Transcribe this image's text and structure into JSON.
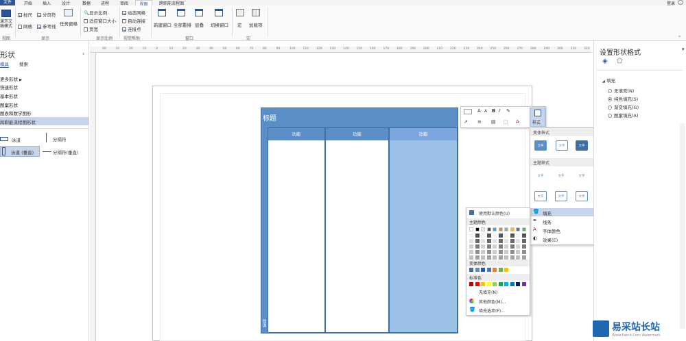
{
  "ribbon": {
    "tabs": [
      {
        "label": "文件"
      },
      {
        "label": "开始"
      },
      {
        "label": "插入"
      },
      {
        "label": "设计"
      },
      {
        "label": "数据"
      },
      {
        "label": "进程"
      },
      {
        "label": "审阅"
      },
      {
        "label": "视图"
      },
      {
        "label": "跨职能流程图"
      }
    ],
    "login": "登录",
    "present": "演示文\n稿模式",
    "checks": {
      "ruler": "标尺",
      "grid": "网格",
      "pagebreak": "分页符",
      "guides": "参考线"
    },
    "task_pane": "任务窗格",
    "zoom": {
      "show": "显示比例",
      "fit": "适应窗口大小",
      "page": "页宽"
    },
    "helpers": {
      "dyn_grid": "动态网格",
      "autoconnect": "自动连接",
      "connpoints": "连接点"
    },
    "win": {
      "new": "新建窗口",
      "all": "全部重排",
      "cascade": "层叠",
      "switch": "切换窗口"
    },
    "macro": "宏",
    "addin": "加载项",
    "groups": {
      "view": "视图",
      "show": "显示",
      "zoom": "显示比例",
      "visual": "视觉帮助",
      "window": "窗口",
      "macro": "宏"
    }
  },
  "shapes": {
    "title": "形状",
    "tab_stencil": "模具",
    "tab_search": "搜索",
    "items": [
      {
        "label": "更多形状"
      },
      {
        "label": "快速形状"
      },
      {
        "label": "基本形状"
      },
      {
        "label": "图案形状"
      },
      {
        "label": "图表和数学图形"
      },
      {
        "label": "跨职能流程图形状"
      }
    ],
    "stencil": {
      "swimlane": "泳道",
      "separator": "分隔符",
      "swimlane_v": "泳道 (垂直)",
      "separator_v": "分隔符(垂直)"
    }
  },
  "ruler_numbers": [
    "40",
    "30",
    "20",
    "10",
    "0",
    "10",
    "20",
    "30",
    "40",
    "50",
    "60",
    "70",
    "80",
    "90",
    "100",
    "110",
    "120",
    "130",
    "140",
    "150",
    "160",
    "170",
    "180",
    "190",
    "200",
    "210",
    "220",
    "230",
    "240",
    "250",
    "260",
    "270",
    "280",
    "290",
    "300",
    "310",
    "320"
  ],
  "diagram": {
    "title": "标题",
    "columns": [
      {
        "label": "功能"
      },
      {
        "label": "功能"
      },
      {
        "label": "功能"
      }
    ],
    "phase": "阶段"
  },
  "mini_toolbar": {
    "style_label": "样式",
    "font_a": "A",
    "bold": "B",
    "italic": "I"
  },
  "style_gallery": {
    "variant_header": "变体样式",
    "theme_header": "主题样式",
    "chip_text": "文字",
    "fill": "填充",
    "line": "线条",
    "font_color": "字体颜色",
    "effects": "效果(E)"
  },
  "color_menu": {
    "auto": "使用默认颜色(U)",
    "theme_header": "主题颜色",
    "variant_header": "变体颜色",
    "standard_header": "标准色",
    "no_fill": "无填充(N)",
    "more": "其他颜色(M)...",
    "options": "填充选项(F)..."
  },
  "format_pane": {
    "title": "设置形状格式",
    "section": "填充",
    "options": [
      {
        "label": "无填充(N)",
        "on": false
      },
      {
        "label": "纯色填充(S)",
        "on": true
      },
      {
        "label": "渐变填充(G)",
        "on": false
      },
      {
        "label": "图案填充(A)",
        "on": false
      }
    ]
  },
  "watermark": {
    "main": "易采站长站",
    "sub": "Www.Easck.Com Watermark"
  }
}
